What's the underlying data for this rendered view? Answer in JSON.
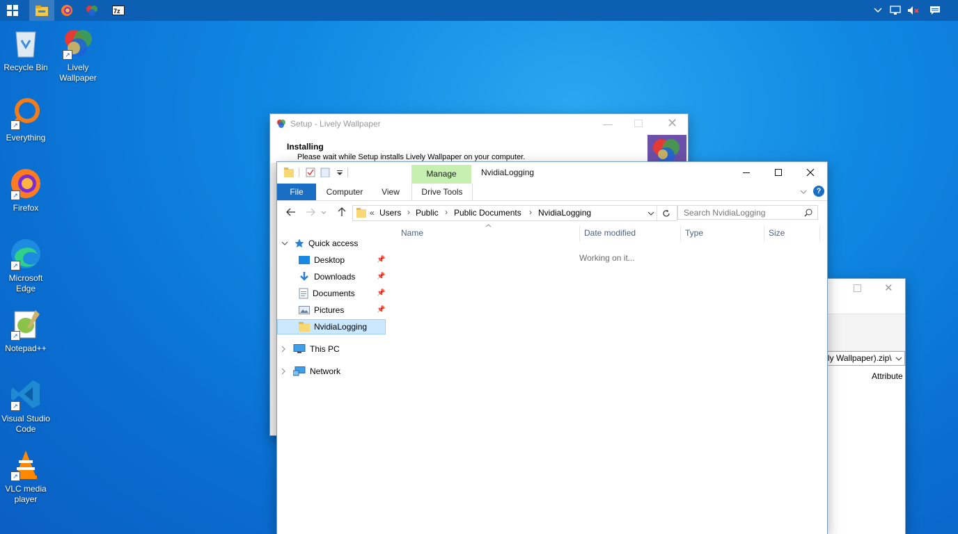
{
  "taskbar": {
    "start_icon": "windows-logo-icon",
    "pinned": [
      "file-explorer-icon",
      "firefox-icon",
      "lively-wallpaper-icon",
      "7zip-icon"
    ]
  },
  "desktop": {
    "icons": [
      {
        "label": "Recycle Bin",
        "icon": "recycle-bin-icon"
      },
      {
        "label": "Lively Wallpaper",
        "icon": "lively-wallpaper-icon"
      },
      {
        "label": "Everything",
        "icon": "everything-search-icon"
      },
      {
        "label": "Firefox",
        "icon": "firefox-icon"
      },
      {
        "label": "Microsoft Edge",
        "icon": "edge-icon"
      },
      {
        "label": "Notepad++",
        "icon": "notepad-plus-plus-icon"
      },
      {
        "label": "Visual Studio Code",
        "icon": "vscode-icon"
      },
      {
        "label": "VLC media player",
        "icon": "vlc-icon"
      }
    ]
  },
  "setup": {
    "title": "Setup - Lively Wallpaper",
    "heading": "Installing",
    "subheading": "Please wait while Setup installs Lively Wallpaper on your computer."
  },
  "back_window": {
    "path_fragment": "ly Wallpaper).zip\\",
    "column": "Attribute"
  },
  "explorer": {
    "title": "NvidiaLogging",
    "manage_tab": "Manage",
    "tabs": {
      "file": "File",
      "computer": "Computer",
      "view": "View",
      "drive_tools": "Drive Tools"
    },
    "address": {
      "overflow": "«",
      "parts": [
        "Users",
        "Public",
        "Public Documents",
        "NvidiaLogging"
      ]
    },
    "search_placeholder": "Search NvidiaLogging",
    "columns": {
      "name": "Name",
      "date": "Date modified",
      "type": "Type",
      "size": "Size"
    },
    "status": "Working on it...",
    "nav": {
      "quick_access": "Quick access",
      "items": [
        "Desktop",
        "Downloads",
        "Documents",
        "Pictures",
        "NvidiaLogging"
      ],
      "this_pc": "This PC",
      "network": "Network"
    }
  },
  "colors": {
    "accent": "#1a6fc4",
    "manage": "#c7f0b0",
    "selected": "#cce8ff"
  }
}
